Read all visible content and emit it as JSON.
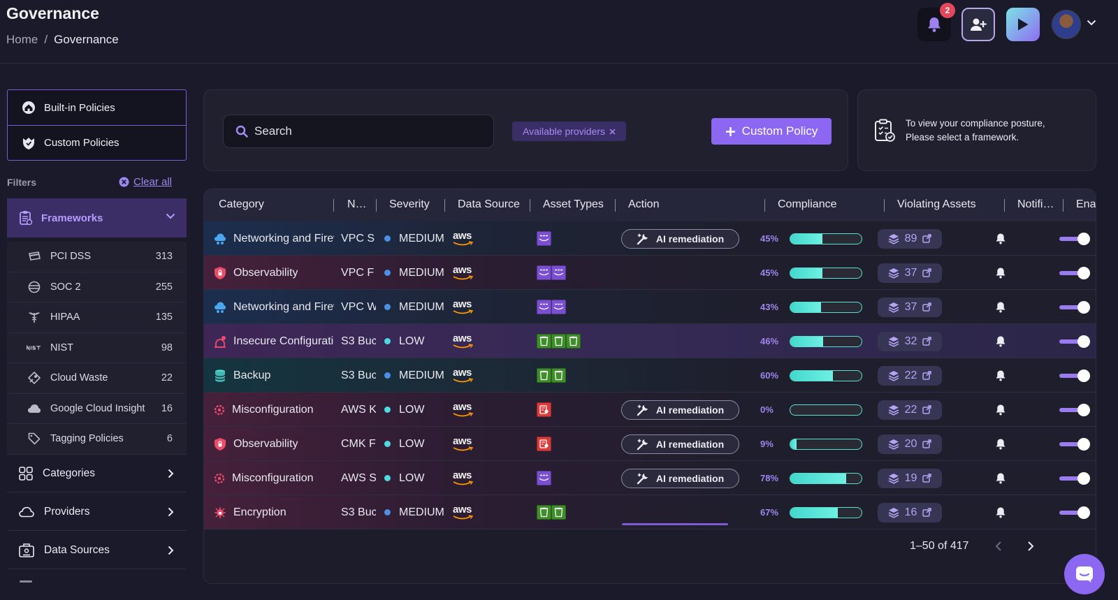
{
  "header": {
    "title": "Governance",
    "breadcrumb": {
      "home": "Home",
      "separator": "/",
      "current": "Governance"
    },
    "notifications_count": "2",
    "icons": [
      "bell-icon",
      "add-user-icon",
      "play-icon",
      "avatar",
      "chevron-down-icon"
    ]
  },
  "sidebar": {
    "policy_types": [
      {
        "label": "Built-in Policies",
        "icon": "house-icon"
      },
      {
        "label": "Custom Policies",
        "icon": "shield-icon"
      }
    ],
    "filters_label": "Filters",
    "clear_all": "Clear all",
    "frameworks": {
      "label": "Frameworks",
      "items": [
        {
          "label": "PCI DSS",
          "count": "313",
          "icon": "card-icon"
        },
        {
          "label": "SOC 2",
          "count": "255",
          "icon": "globe-icon"
        },
        {
          "label": "HIPAA",
          "count": "135",
          "icon": "caduceus-icon"
        },
        {
          "label": "NIST",
          "count": "98",
          "icon": "nist-logo"
        },
        {
          "label": "Cloud Waste",
          "count": "22",
          "icon": "recycle-icon"
        },
        {
          "label": "Google Cloud Insight",
          "count": "16",
          "icon": "cloud-icon"
        },
        {
          "label": "Tagging Policies",
          "count": "6",
          "icon": "tag-icon"
        }
      ]
    },
    "sections": [
      {
        "label": "Categories",
        "icon": "grid-icon"
      },
      {
        "label": "Providers",
        "icon": "cloud-icon"
      },
      {
        "label": "Data Sources",
        "icon": "database-icon"
      }
    ]
  },
  "search": {
    "placeholder": "Search",
    "provider_chip": "Available providers",
    "custom_policy_button": "Custom Policy"
  },
  "hint": {
    "line1": "To view your compliance posture,",
    "line2": "Please select a framework."
  },
  "table": {
    "columns": [
      "Category",
      "N…",
      "Severity",
      "Data Source",
      "Asset Types",
      "Action",
      "Compliance",
      "Violating Assets",
      "Notifi…",
      "Ena"
    ],
    "rows": [
      {
        "category": "Networking and Firewall",
        "name": "VPC S",
        "severity": "MEDIUM",
        "source": "aws",
        "assets": [
          "purple"
        ],
        "action": "AI remediation",
        "compliance_pct": "45%",
        "compliance": 45,
        "violating": "89",
        "style": "row-blue",
        "cat_icon": "network-icon",
        "sev_color": "#4c8fe6"
      },
      {
        "category": "Observability",
        "name": "VPC F",
        "severity": "MEDIUM",
        "source": "aws",
        "assets": [
          "purple",
          "purple"
        ],
        "action": "",
        "compliance_pct": "45%",
        "compliance": 45,
        "violating": "37",
        "style": "row-pink",
        "cat_icon": "observability-icon",
        "sev_color": "#4c8fe6"
      },
      {
        "category": "Networking and Firewall",
        "name": "VPC W",
        "severity": "MEDIUM",
        "source": "aws",
        "assets": [
          "purple",
          "purple"
        ],
        "action": "",
        "compliance_pct": "43%",
        "compliance": 43,
        "violating": "37",
        "style": "row-blue",
        "cat_icon": "network-icon",
        "sev_color": "#4c8fe6"
      },
      {
        "category": "Insecure Configuration",
        "name": "S3 Buc",
        "severity": "LOW",
        "source": "aws",
        "assets": [
          "green",
          "green",
          "green"
        ],
        "action": "",
        "compliance_pct": "46%",
        "compliance": 46,
        "violating": "32",
        "style": "row-purple",
        "cat_icon": "insecure-icon",
        "sev_color": "#4fd9e0"
      },
      {
        "category": "Backup",
        "name": "S3 Buc",
        "severity": "MEDIUM",
        "source": "aws",
        "assets": [
          "green",
          "green"
        ],
        "action": "",
        "compliance_pct": "60%",
        "compliance": 60,
        "violating": "22",
        "style": "row-teal",
        "cat_icon": "backup-icon",
        "sev_color": "#4c8fe6"
      },
      {
        "category": "Misconfiguration",
        "name": "AWS K",
        "severity": "LOW",
        "source": "aws",
        "assets": [
          "red"
        ],
        "action": "AI remediation",
        "compliance_pct": "0%",
        "compliance": 0,
        "violating": "22",
        "style": "row-pink",
        "cat_icon": "misconfig-icon",
        "sev_color": "#4fd9e0"
      },
      {
        "category": "Observability",
        "name": "CMK F",
        "severity": "LOW",
        "source": "aws",
        "assets": [
          "red"
        ],
        "action": "AI remediation",
        "compliance_pct": "9%",
        "compliance": 9,
        "violating": "20",
        "style": "row-pink",
        "cat_icon": "observability-icon",
        "sev_color": "#4fd9e0"
      },
      {
        "category": "Misconfiguration",
        "name": "AWS S",
        "severity": "LOW",
        "source": "aws",
        "assets": [
          "purple"
        ],
        "action": "AI remediation",
        "compliance_pct": "78%",
        "compliance": 78,
        "violating": "19",
        "style": "row-pink",
        "cat_icon": "misconfig-icon",
        "sev_color": "#4fd9e0"
      },
      {
        "category": "Encryption",
        "name": "S3 Buc",
        "severity": "MEDIUM",
        "source": "aws",
        "assets": [
          "green",
          "green"
        ],
        "action": "",
        "compliance_pct": "67%",
        "compliance": 67,
        "violating": "16",
        "style": "row-pink",
        "cat_icon": "encryption-icon",
        "sev_color": "#4c8fe6"
      }
    ],
    "pagination": "1–50 of 417"
  },
  "colors": {
    "accent": "#8b67f2",
    "background": "#1a1a2b",
    "panel": "#20202f",
    "compliance_bar": "#5ae0d0",
    "medium_dot": "#4c8fe6",
    "low_dot": "#4fd9e0"
  }
}
